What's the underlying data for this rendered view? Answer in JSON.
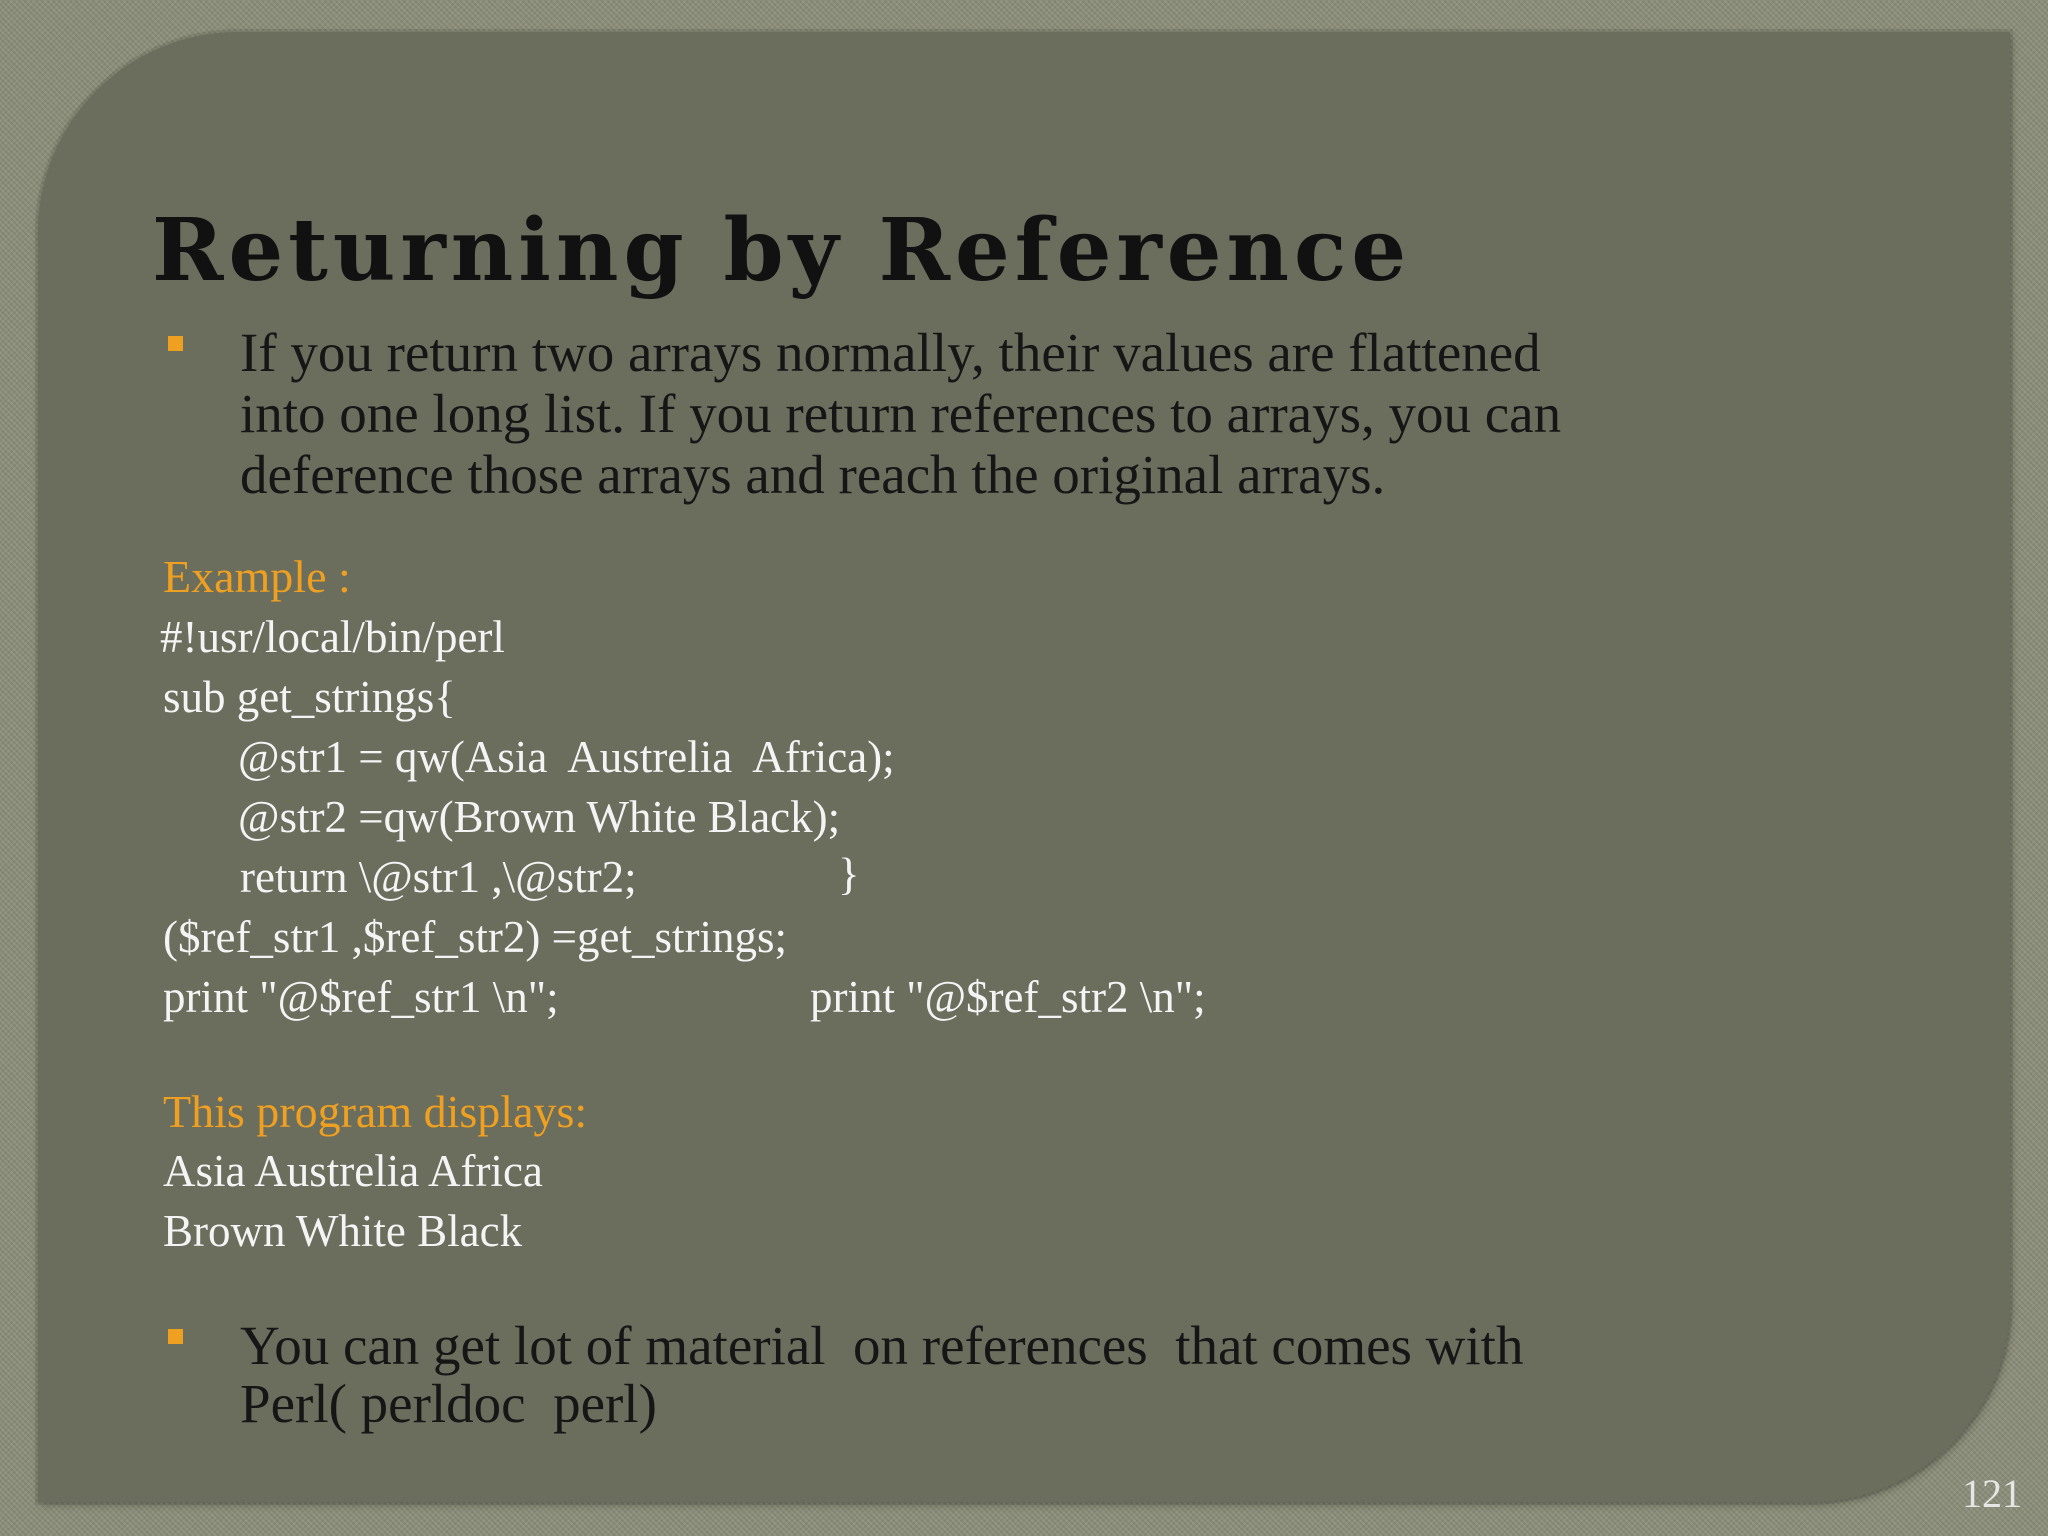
{
  "slide": {
    "title": "Returning by Reference",
    "bullet1": {
      "lines": [
        "If you return two arrays normally, their values are flattened",
        "into one long list. If you return references to arrays, you can",
        "deference those arrays and reach the original arrays."
      ]
    },
    "example_label": "Example :",
    "code": {
      "line1": "#!usr/local/bin/perl",
      "line2": "sub get_strings{",
      "line3": "@str1 = qw(Asia  Austrelia  Africa);",
      "line4": "@str2 =qw(Brown White Black);",
      "line5a": "return \\@str1 ,\\@str2;",
      "line5b": "}",
      "line6": "($ref_str1 ,$ref_str2) =get_strings;",
      "line7a": "print \"@$ref_str1 \\n\";",
      "line7b": "print \"@$ref_str2 \\n\";"
    },
    "output_label": "This program displays:",
    "output": {
      "line1": "Asia Austrelia Africa",
      "line2": "Brown White Black"
    },
    "bullet2": {
      "lines": [
        "You can get lot of material  on references  that comes with",
        "Perl( perldoc  perl)"
      ]
    },
    "page_number": "121"
  },
  "colors": {
    "background": "#8a8d78",
    "panel": "#6b6d5d",
    "title": "#111111",
    "accent_orange": "#f0a020",
    "code_text": "#f4f4f4"
  },
  "icons": {
    "bullet": "square-bullet-icon"
  }
}
